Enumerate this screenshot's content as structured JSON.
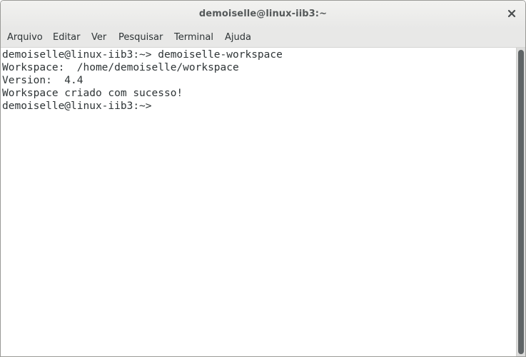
{
  "window": {
    "title": "demoiselle@linux-iib3:~",
    "close_icon": "close-icon"
  },
  "menubar": {
    "items": [
      {
        "label": "Arquivo"
      },
      {
        "label": "Editar"
      },
      {
        "label": "Ver"
      },
      {
        "label": "Pesquisar"
      },
      {
        "label": "Terminal"
      },
      {
        "label": "Ajuda"
      }
    ]
  },
  "terminal": {
    "lines": [
      "demoiselle@linux-iib3:~> demoiselle-workspace",
      "Workspace:  /home/demoiselle/workspace",
      "Version:  4.4",
      "Workspace criado com sucesso!",
      "demoiselle@linux-iib3:~> "
    ]
  },
  "colors": {
    "text": "#2e3436",
    "background": "#ffffff",
    "chrome": "#e8e8e7",
    "scroll_thumb": "#5f6466"
  }
}
